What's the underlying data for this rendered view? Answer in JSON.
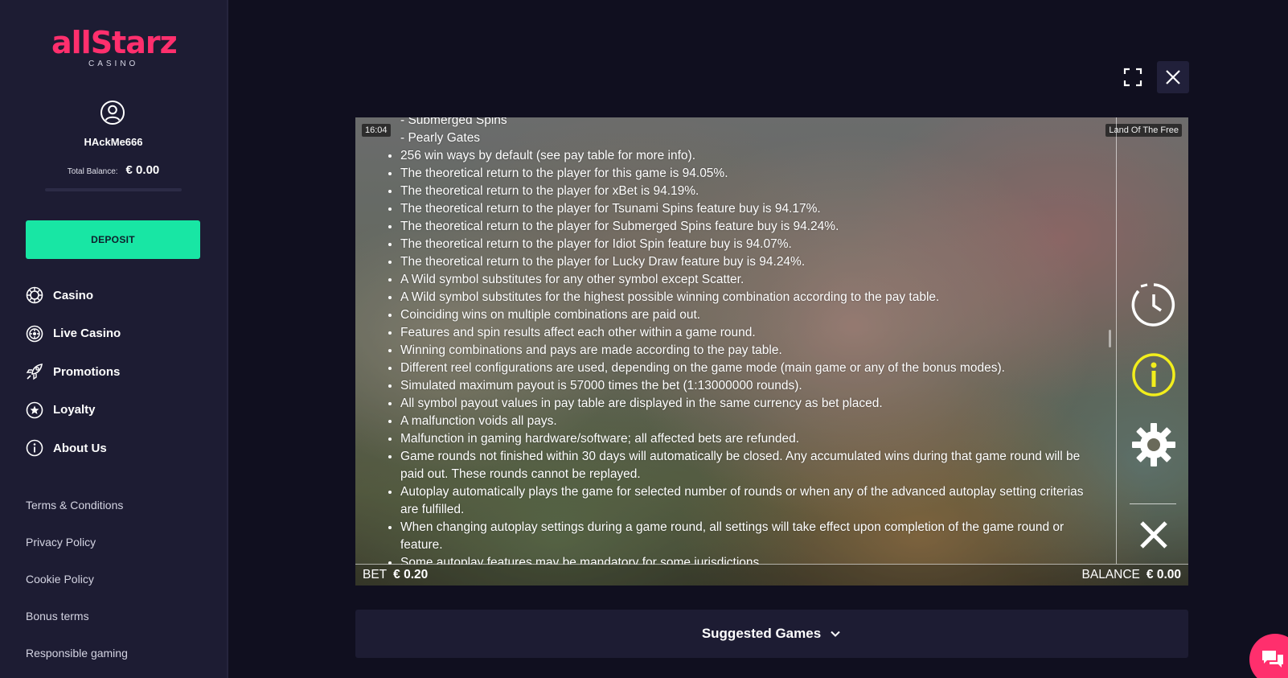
{
  "brand": {
    "logo_text": "allStarz",
    "logo_sub": "CASINO",
    "accent": "#ff2f6d",
    "deposit_color": "#18e6a4"
  },
  "user": {
    "name": "HAckMe666",
    "balance_label": "Total Balance:",
    "balance_value": "€ 0.00"
  },
  "deposit_label": "DEPOSIT",
  "nav": [
    {
      "label": "Casino",
      "icon": "casino-chip-icon"
    },
    {
      "label": "Live Casino",
      "icon": "roulette-icon"
    },
    {
      "label": "Promotions",
      "icon": "rocket-icon"
    },
    {
      "label": "Loyalty",
      "icon": "star-circle-icon"
    },
    {
      "label": "About Us",
      "icon": "info-icon"
    }
  ],
  "links": [
    "Terms & Conditions",
    "Privacy Policy",
    "Cookie Policy",
    "Bonus terms",
    "Responsible gaming"
  ],
  "game": {
    "clock": "16:04",
    "title": "Land Of The Free",
    "sub_items": [
      "- Submerged Spins",
      "- Pearly Gates"
    ],
    "rules": [
      "256 win ways by default (see pay table for more info).",
      "The theoretical return to the player for this game is 94.05%.",
      "The theoretical return to the player for xBet is 94.19%.",
      "The theoretical return to the player for Tsunami Spins feature buy is 94.17%.",
      "The theoretical return to the player for Submerged Spins feature buy is 94.24%.",
      "The theoretical return to the player for Idiot Spin feature buy is 94.07%.",
      "The theoretical return to the player for Lucky Draw feature buy is 94.24%.",
      "A Wild symbol substitutes for any other symbol except Scatter.",
      "A Wild symbol substitutes for the highest possible winning combination according to the pay table.",
      "Coinciding wins on multiple combinations are paid out.",
      "Features and spin results affect each other within a game round.",
      "Winning combinations and pays are made according to the pay table.",
      "Different reel configurations are used, depending on the game mode (main game or any of the bonus modes).",
      "Simulated maximum payout is 57000 times the bet (1:13000000 rounds).",
      "All symbol payout values in pay table are displayed in the same currency as bet placed.",
      "A malfunction voids all pays.",
      "Malfunction in gaming hardware/software; all affected bets are refunded.",
      "Game rounds not finished within 30 days will automatically be closed. Any accumulated wins during that game round will be paid out. These rounds cannot be replayed.",
      "Autoplay automatically plays the game for selected number of rounds or when any of the advanced autoplay setting criterias are fulfilled.",
      "When changing autoplay settings during a game round, all settings will take effect upon completion of the game round or feature.",
      "Some autoplay features may be mandatory for some jurisdictions."
    ],
    "bet_label": "BET",
    "bet_value": "€ 0.20",
    "balance_label": "BALANCE",
    "balance_value": "€ 0.00",
    "info_color": "#f2ee1c"
  },
  "suggested_label": "Suggested Games"
}
